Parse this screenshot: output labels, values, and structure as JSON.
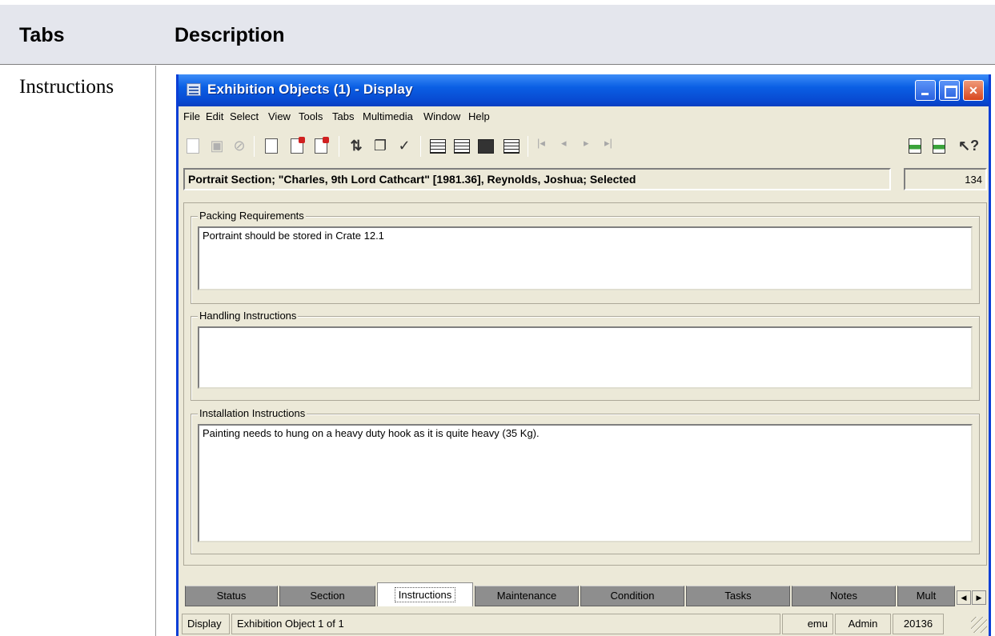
{
  "table": {
    "col_tabs": "Tabs",
    "col_description": "Description",
    "row_label": "Instructions"
  },
  "window": {
    "title": "Exhibition Objects (1) - Display",
    "menu": [
      "File",
      "Edit",
      "Select",
      "View",
      "Tools",
      "Tabs",
      "Multimedia",
      "Window",
      "Help"
    ],
    "toolbar_icons": [
      "new-icon",
      "save-icon",
      "cancel-icon",
      "insert-record-icon",
      "copy-record-icon",
      "delete-record-icon",
      "sort-icon",
      "report-icon",
      "spellcheck-icon",
      "list-view-icon",
      "grid-view-icon",
      "page-view-icon",
      "details-view-icon",
      "first-record-icon",
      "prev-record-icon",
      "next-record-icon",
      "last-record-icon",
      "attach-icon",
      "detach-icon",
      "help-pointer-icon"
    ],
    "summary": "Portrait Section; \"Charles, 9th Lord Cathcart\" [1981.36], Reynolds, Joshua; Selected",
    "record_count": "134"
  },
  "groups": {
    "packing": {
      "label": "Packing Requirements",
      "value": "Portraint should be stored in Crate 12.1"
    },
    "handling": {
      "label": "Handling Instructions",
      "value": ""
    },
    "installation": {
      "label": "Installation Instructions",
      "value": "Painting needs to hung on a heavy duty hook as it is quite heavy (35 Kg)."
    }
  },
  "tabs": [
    "Status",
    "Section",
    "Instructions",
    "Maintenance",
    "Condition",
    "Tasks",
    "Notes",
    "Mult"
  ],
  "active_tab": "Instructions",
  "statusbar": {
    "mode": "Display",
    "record": "Exhibition Object 1 of 1",
    "db": "emu",
    "user": "Admin",
    "number": "20136"
  }
}
